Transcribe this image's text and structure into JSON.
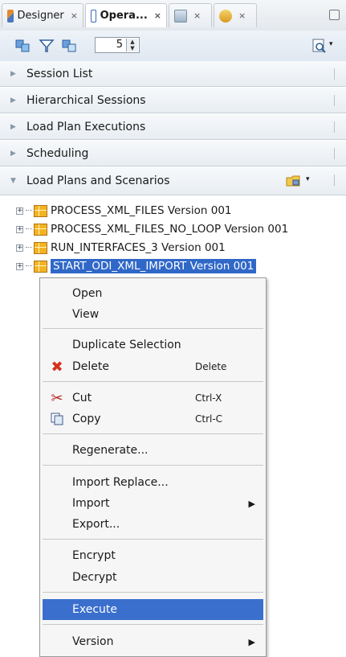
{
  "tabs": [
    {
      "label": "Designer",
      "close": "×",
      "icon": "designer-icon"
    },
    {
      "label": "Opera...",
      "close": "×",
      "icon": "operator-icon"
    },
    {
      "label": "",
      "close": "×",
      "icon": "topology-icon"
    },
    {
      "label": "",
      "close": "×",
      "icon": "security-icon"
    },
    {
      "label": "",
      "close": "",
      "icon": "minimize-icon"
    }
  ],
  "toolbar": {
    "spinner_value": "5"
  },
  "accordions": [
    {
      "label": "Session List"
    },
    {
      "label": "Hierarchical Sessions"
    },
    {
      "label": "Load Plan Executions"
    },
    {
      "label": "Scheduling"
    },
    {
      "label": "Load Plans and Scenarios"
    }
  ],
  "tree": [
    {
      "label": "PROCESS_XML_FILES Version 001"
    },
    {
      "label": "PROCESS_XML_FILES_NO_LOOP Version 001"
    },
    {
      "label": "RUN_INTERFACES_3 Version 001"
    },
    {
      "label": "START_ODI_XML_IMPORT Version 001",
      "selected": true
    }
  ],
  "menu": {
    "open": "Open",
    "view": "View",
    "duplicate": "Duplicate Selection",
    "delete": "Delete",
    "delete_accel": "Delete",
    "cut": "Cut",
    "cut_accel": "Ctrl-X",
    "copy": "Copy",
    "copy_accel": "Ctrl-C",
    "regenerate": "Regenerate...",
    "import_replace": "Import Replace...",
    "import": "Import",
    "export": "Export...",
    "encrypt": "Encrypt",
    "decrypt": "Decrypt",
    "execute": "Execute",
    "version": "Version",
    "submenu_arrow": "▶"
  },
  "colors": {
    "selection": "#3068c8",
    "menu_highlight": "#3a6fcd"
  }
}
